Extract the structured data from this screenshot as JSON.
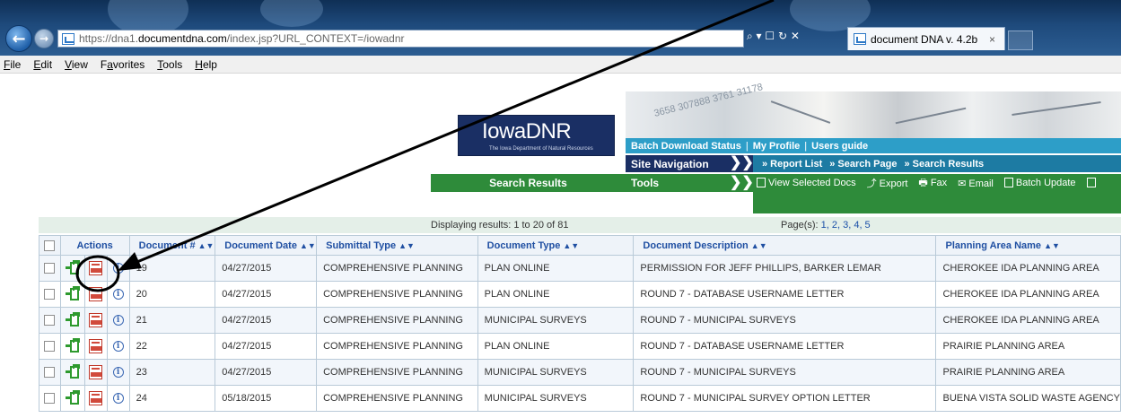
{
  "browser": {
    "url_prefix": "https://dna1.",
    "url_domain": "documentdna.com",
    "url_rest": "/index.jsp?URL_CONTEXT=/iowadnr",
    "address_tools": "⌕ ▾ ☐ ↻ ✕",
    "tab_title": "document DNA v. 4.2b",
    "tab_close": "×"
  },
  "menu": [
    {
      "key": "F",
      "rest": "ile"
    },
    {
      "key": "E",
      "rest": "dit"
    },
    {
      "key": "V",
      "rest": "iew"
    },
    {
      "pre": "F",
      "key": "a",
      "rest": "vorites"
    },
    {
      "key": "T",
      "rest": "ools"
    },
    {
      "key": "H",
      "rest": "elp"
    }
  ],
  "logo": {
    "main": "IowaDNR",
    "sub": "The Iowa Department of Natural Resources"
  },
  "photo_numbers": "3658 307888 3761 31178",
  "utility": {
    "batch": "Batch Download Status",
    "sep": "|",
    "profile": "My Profile",
    "guide": "Users guide"
  },
  "site_nav": {
    "label": "Site Navigation",
    "links": [
      "» Report List",
      "» Search Page",
      "» Search Results"
    ]
  },
  "page_heading": "Search Results",
  "tools": {
    "label": "Tools",
    "view": "View Selected Docs",
    "export": "Export",
    "fax": "Fax",
    "email": "Email",
    "batch_update": "Batch Update"
  },
  "status": {
    "displaying": "Displaying results: 1 to 20 of 81",
    "pages_label": "Page(s): ",
    "pages": "1, 2, 3, 4, 5"
  },
  "table": {
    "headers": {
      "actions": "Actions",
      "doc_num": "Document #",
      "doc_date": "Document Date",
      "submittal": "Submittal Type",
      "doc_type": "Document Type",
      "description": "Document Description",
      "planning": "Planning Area Name"
    },
    "sort_icon": "▲▼",
    "info_glyph": "i",
    "rows": [
      {
        "num": "19",
        "date": "04/27/2015",
        "submittal": "COMPREHENSIVE PLANNING",
        "type": "PLAN ONLINE",
        "desc": "PERMISSION FOR JEFF PHILLIPS, BARKER LEMAR",
        "area": "CHEROKEE IDA PLANNING AREA"
      },
      {
        "num": "20",
        "date": "04/27/2015",
        "submittal": "COMPREHENSIVE PLANNING",
        "type": "PLAN ONLINE",
        "desc": "ROUND 7 - DATABASE USERNAME LETTER",
        "area": "CHEROKEE IDA PLANNING AREA"
      },
      {
        "num": "21",
        "date": "04/27/2015",
        "submittal": "COMPREHENSIVE PLANNING",
        "type": "MUNICIPAL SURVEYS",
        "desc": "ROUND 7 - MUNICIPAL SURVEYS",
        "area": "CHEROKEE IDA PLANNING AREA"
      },
      {
        "num": "22",
        "date": "04/27/2015",
        "submittal": "COMPREHENSIVE PLANNING",
        "type": "PLAN ONLINE",
        "desc": "ROUND 7 - DATABASE USERNAME LETTER",
        "area": "PRAIRIE PLANNING AREA"
      },
      {
        "num": "23",
        "date": "04/27/2015",
        "submittal": "COMPREHENSIVE PLANNING",
        "type": "MUNICIPAL SURVEYS",
        "desc": "ROUND 7 - MUNICIPAL SURVEYS",
        "area": "PRAIRIE PLANNING AREA"
      },
      {
        "num": "24",
        "date": "05/18/2015",
        "submittal": "COMPREHENSIVE PLANNING",
        "type": "MUNICIPAL SURVEYS",
        "desc": "ROUND 7 - MUNICIPAL SURVEY OPTION LETTER",
        "area": "BUENA VISTA SOLID WASTE AGENCY"
      }
    ]
  },
  "colors": {
    "site_nav_dark": "#1a2f64",
    "teal": "#2d9ec8",
    "green": "#2e8b3a",
    "header_text": "#1f4fa2",
    "annotation": "#000000"
  }
}
